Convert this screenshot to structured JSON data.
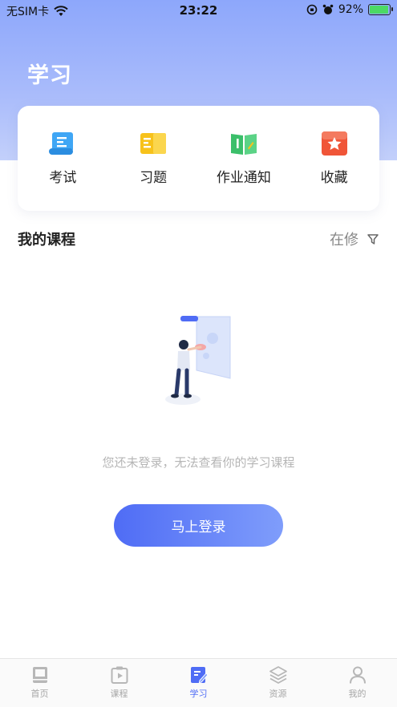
{
  "status_bar": {
    "carrier": "无SIM卡",
    "time": "23:22",
    "battery": "92%"
  },
  "header": {
    "title": "学习"
  },
  "quick_actions": [
    {
      "label": "考试",
      "icon": "scroll-icon",
      "color": "#3fa6f5"
    },
    {
      "label": "习题",
      "icon": "folder-icon",
      "color": "#f7c21b"
    },
    {
      "label": "作业通知",
      "icon": "book-icon",
      "color": "#3bbf6a"
    },
    {
      "label": "收藏",
      "icon": "star-icon",
      "color": "#f05538"
    }
  ],
  "courses": {
    "title": "我的课程",
    "filter_label": "在修"
  },
  "empty_state": {
    "message": "您还未登录，无法查看你的学习课程",
    "login_button": "马上登录"
  },
  "tab_bar": {
    "active_index": 2,
    "active_color": "#4f6cf5",
    "items": [
      {
        "label": "首页",
        "icon": "home-book-icon"
      },
      {
        "label": "课程",
        "icon": "course-play-icon"
      },
      {
        "label": "学习",
        "icon": "study-edit-icon"
      },
      {
        "label": "资源",
        "icon": "layers-icon"
      },
      {
        "label": "我的",
        "icon": "person-icon"
      }
    ]
  }
}
